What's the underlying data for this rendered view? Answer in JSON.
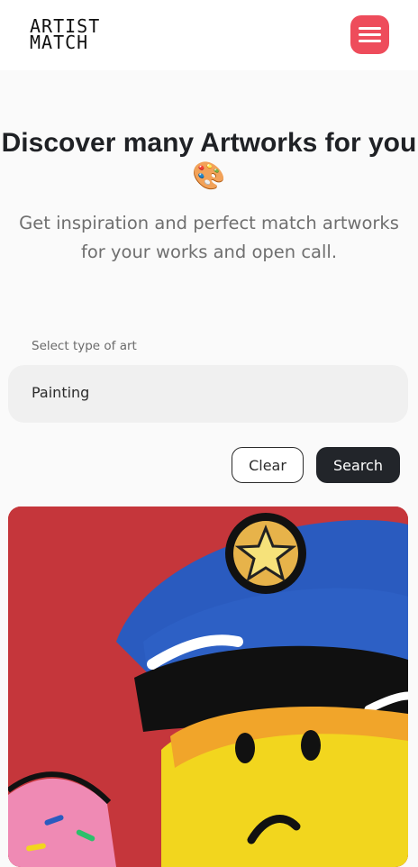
{
  "header": {
    "logo_line1": "ARTIST",
    "logo_line2": "MATCH",
    "menu_icon": "hamburger-menu-icon",
    "accent_color": "#ee4c5b"
  },
  "hero": {
    "title": "Discover many Artworks for you",
    "emoji": "🎨",
    "subtitle": "Get inspiration and perfect match artworks for your works and open call."
  },
  "filter": {
    "label": "Select type of art",
    "selected_value": "Painting",
    "clear_label": "Clear",
    "search_label": "Search"
  },
  "artwork": {
    "icon": "artwork-image"
  }
}
